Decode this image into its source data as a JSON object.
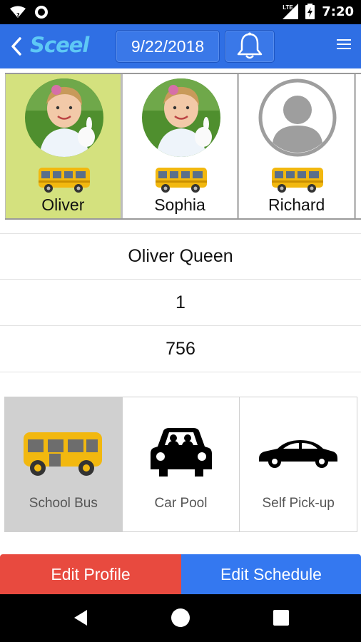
{
  "status_bar": {
    "time": "7:20",
    "network": "LTE"
  },
  "app_bar": {
    "logo_text": "Sceel",
    "date": "9/22/2018",
    "icons": [
      "back-arrow-icon",
      "bell-icon",
      "hamburger-menu-icon"
    ]
  },
  "students": [
    {
      "name": "Oliver",
      "selected": true,
      "photo": "child-photo",
      "transport_icon": "school-bus-icon"
    },
    {
      "name": "Sophia",
      "selected": false,
      "photo": "child-photo",
      "transport_icon": "school-bus-icon"
    },
    {
      "name": "Richard",
      "selected": false,
      "photo": "default-avatar",
      "transport_icon": "school-bus-icon"
    }
  ],
  "details": {
    "full_name": "Oliver Queen",
    "grade": "1",
    "id": "756"
  },
  "transport_options": [
    {
      "label": "School Bus",
      "icon": "school-bus-icon",
      "selected": true
    },
    {
      "label": "Car Pool",
      "icon": "car-pool-icon",
      "selected": false
    },
    {
      "label": "Self Pick-up",
      "icon": "car-icon",
      "selected": false
    }
  ],
  "actions": {
    "edit_profile": "Edit Profile",
    "edit_schedule": "Edit Schedule"
  },
  "colors": {
    "app_bar": "#2f6fe4",
    "selected_student": "#d4e17e",
    "selected_option": "#d0d0d0",
    "edit_profile": "#e84a3f",
    "edit_schedule": "#3478f0",
    "bus_yellow": "#f2b80f"
  }
}
